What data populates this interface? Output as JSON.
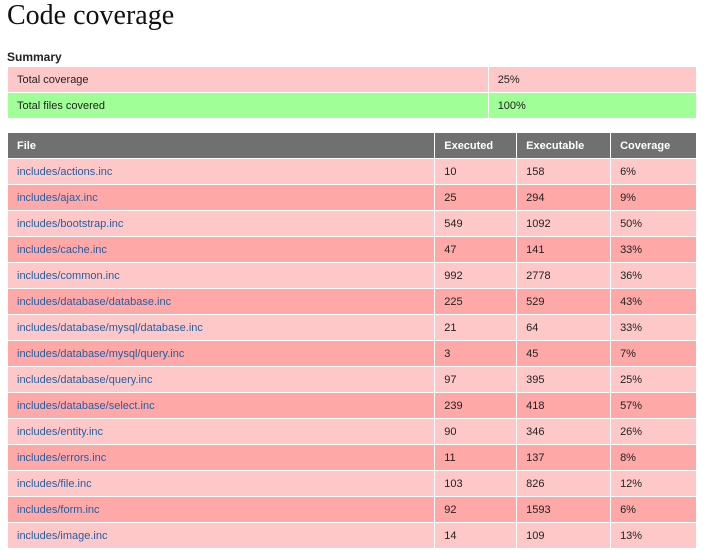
{
  "page": {
    "title": "Code coverage"
  },
  "summary": {
    "heading": "Summary",
    "rows": [
      {
        "label": "Total coverage",
        "value": "25%"
      },
      {
        "label": "Total files covered",
        "value": "100%"
      }
    ]
  },
  "files": {
    "headers": {
      "file": "File",
      "executed": "Executed",
      "executable": "Executable",
      "coverage": "Coverage"
    },
    "rows": [
      {
        "file": "includes/actions.inc",
        "executed": "10",
        "executable": "158",
        "coverage": "6%"
      },
      {
        "file": "includes/ajax.inc",
        "executed": "25",
        "executable": "294",
        "coverage": "9%"
      },
      {
        "file": "includes/bootstrap.inc",
        "executed": "549",
        "executable": "1092",
        "coverage": "50%"
      },
      {
        "file": "includes/cache.inc",
        "executed": "47",
        "executable": "141",
        "coverage": "33%"
      },
      {
        "file": "includes/common.inc",
        "executed": "992",
        "executable": "2778",
        "coverage": "36%"
      },
      {
        "file": "includes/database/database.inc",
        "executed": "225",
        "executable": "529",
        "coverage": "43%"
      },
      {
        "file": "includes/database/mysql/database.inc",
        "executed": "21",
        "executable": "64",
        "coverage": "33%"
      },
      {
        "file": "includes/database/mysql/query.inc",
        "executed": "3",
        "executable": "45",
        "coverage": "7%"
      },
      {
        "file": "includes/database/query.inc",
        "executed": "97",
        "executable": "395",
        "coverage": "25%"
      },
      {
        "file": "includes/database/select.inc",
        "executed": "239",
        "executable": "418",
        "coverage": "57%"
      },
      {
        "file": "includes/entity.inc",
        "executed": "90",
        "executable": "346",
        "coverage": "26%"
      },
      {
        "file": "includes/errors.inc",
        "executed": "11",
        "executable": "137",
        "coverage": "8%"
      },
      {
        "file": "includes/file.inc",
        "executed": "103",
        "executable": "826",
        "coverage": "12%"
      },
      {
        "file": "includes/form.inc",
        "executed": "92",
        "executable": "1593",
        "coverage": "6%"
      },
      {
        "file": "includes/image.inc",
        "executed": "14",
        "executable": "109",
        "coverage": "13%"
      }
    ]
  },
  "colors": {
    "header_bg": "#707070",
    "row_light": "#ffc8c8",
    "row_dark": "#ffa8a8",
    "full_coverage": "#a0ff96",
    "link": "#1f5fa8"
  }
}
